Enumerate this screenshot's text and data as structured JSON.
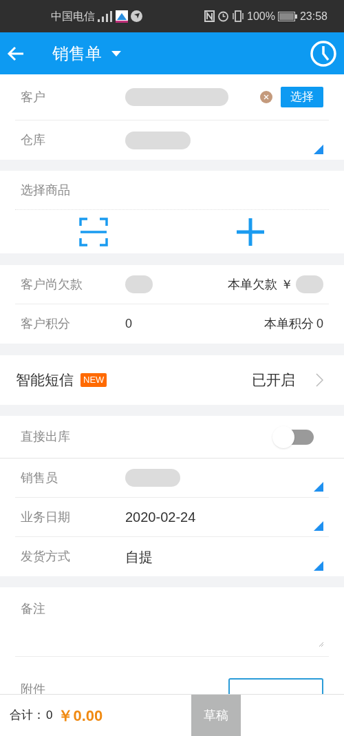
{
  "status_bar": {
    "carrier": "中国电信",
    "battery": "100%",
    "time": "23:58"
  },
  "header": {
    "title": "销售单"
  },
  "customer_block": {
    "rows": [
      {
        "kind": "customer",
        "label": "客户",
        "button": "选择"
      },
      {
        "kind": "dropdown",
        "label": "仓库"
      }
    ]
  },
  "goods_block": {
    "title": "选择商品"
  },
  "balance_block": {
    "rows": [
      {
        "label": "客户尚欠款",
        "right_label": "本单欠款 ￥"
      },
      {
        "label": "客户积分",
        "value": "0",
        "right_label": "本单积分",
        "right_value": "0"
      }
    ]
  },
  "sms": {
    "label": "智能短信",
    "badge": "NEW",
    "status": "已开启"
  },
  "detail_block": {
    "rows": [
      {
        "kind": "toggle",
        "label": "直接出库",
        "on": false
      },
      {
        "kind": "dropdown",
        "label": "销售员"
      },
      {
        "kind": "dropdown",
        "label": "业务日期",
        "value": "2020-02-24"
      },
      {
        "kind": "dropdown",
        "label": "发货方式",
        "value": "自提"
      }
    ]
  },
  "note": {
    "label": "备注"
  },
  "attachment": {
    "label": "附件"
  },
  "footer": {
    "total_label": "合计：",
    "count": "0",
    "amount": "￥0.00",
    "draft_button": "草稿"
  }
}
